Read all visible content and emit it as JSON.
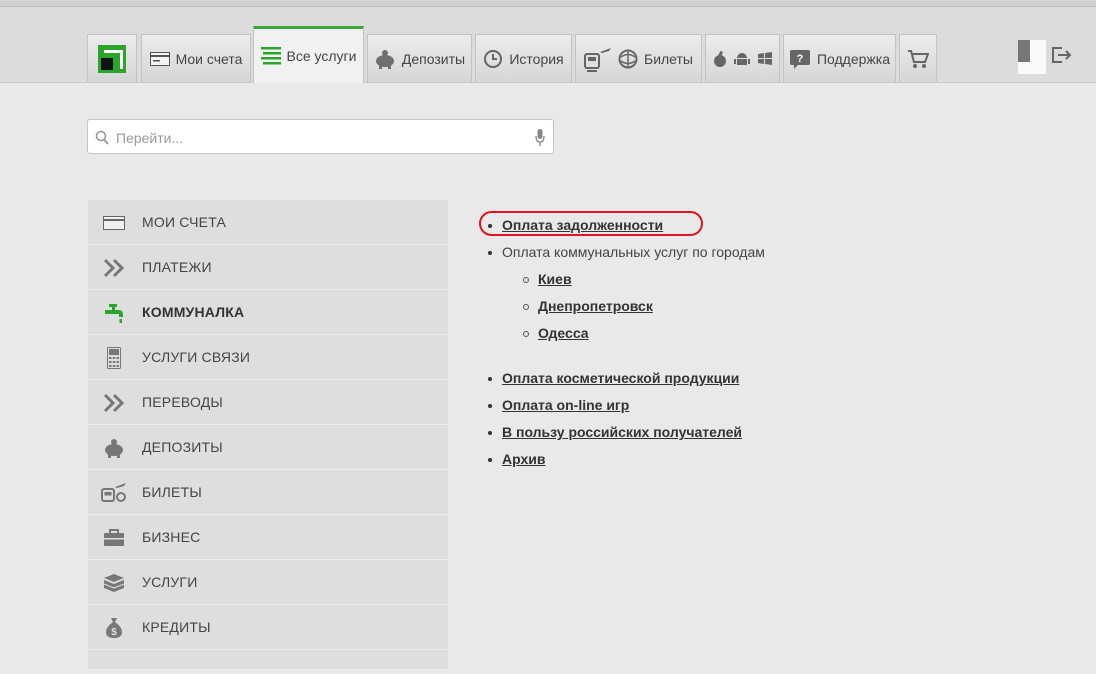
{
  "nav": {
    "tabs": [
      {
        "label": "Мои счета"
      },
      {
        "label": "Все услуги"
      },
      {
        "label": "Депозиты"
      },
      {
        "label": "История"
      },
      {
        "label": "Билеты"
      },
      {
        "label": "Поддержка"
      }
    ]
  },
  "search": {
    "placeholder": "Перейти..."
  },
  "sidebar": {
    "items": [
      {
        "label": "МОИ СЧЕТА"
      },
      {
        "label": "ПЛАТЕЖИ"
      },
      {
        "label": "КОММУНАЛКА"
      },
      {
        "label": "УСЛУГИ СВЯЗИ"
      },
      {
        "label": "ПЕРЕВОДЫ"
      },
      {
        "label": "ДЕПОЗИТЫ"
      },
      {
        "label": "БИЛЕТЫ"
      },
      {
        "label": "БИЗНЕС"
      },
      {
        "label": "УСЛУГИ"
      },
      {
        "label": "КРЕДИТЫ"
      }
    ]
  },
  "content": {
    "debt": "Оплата задолженности",
    "utilities_by_city": "Оплата коммунальных услуг по городам",
    "cities": [
      "Киев",
      "Днепропетровск",
      "Одесса"
    ],
    "cosmetics": "Оплата косметической продукции",
    "online_games": "Оплата on-line игр",
    "russian_recipients": "В пользу российских получателей",
    "archive": "Архив"
  },
  "colors": {
    "accent": "#2aa52a",
    "highlight": "#e0141e"
  }
}
